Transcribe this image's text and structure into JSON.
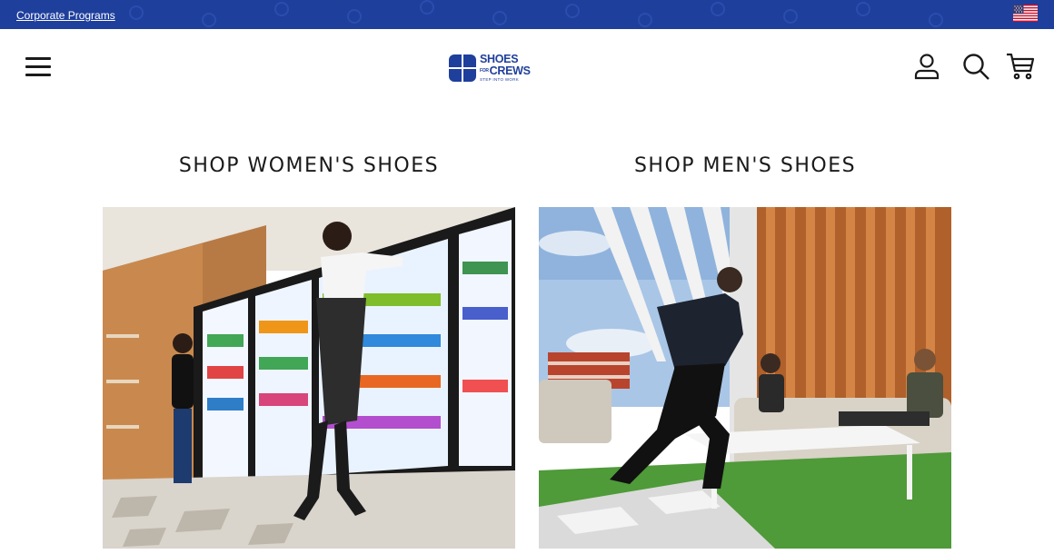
{
  "topbar": {
    "corporate_link": "Corporate Programs",
    "watermark": "go"
  },
  "header": {
    "logo": {
      "line1": "SHOES",
      "line2_small": "FOR",
      "line2": "CREWS",
      "tagline": "STEP INTO WORK"
    },
    "icons": [
      "menu-icon",
      "account-icon",
      "search-icon",
      "cart-icon"
    ]
  },
  "sections": [
    {
      "title": "SHOP WOMEN'S SHOES",
      "image_alt": "Woman in apron stocking a refrigerated beverage case"
    },
    {
      "title": "SHOP MEN'S SHOES",
      "image_alt": "Server placing drinks on a patio table for guests"
    }
  ],
  "colors": {
    "brand_blue": "#1f3f9c",
    "text_dark": "#1a1a1a",
    "background": "#ffffff"
  }
}
